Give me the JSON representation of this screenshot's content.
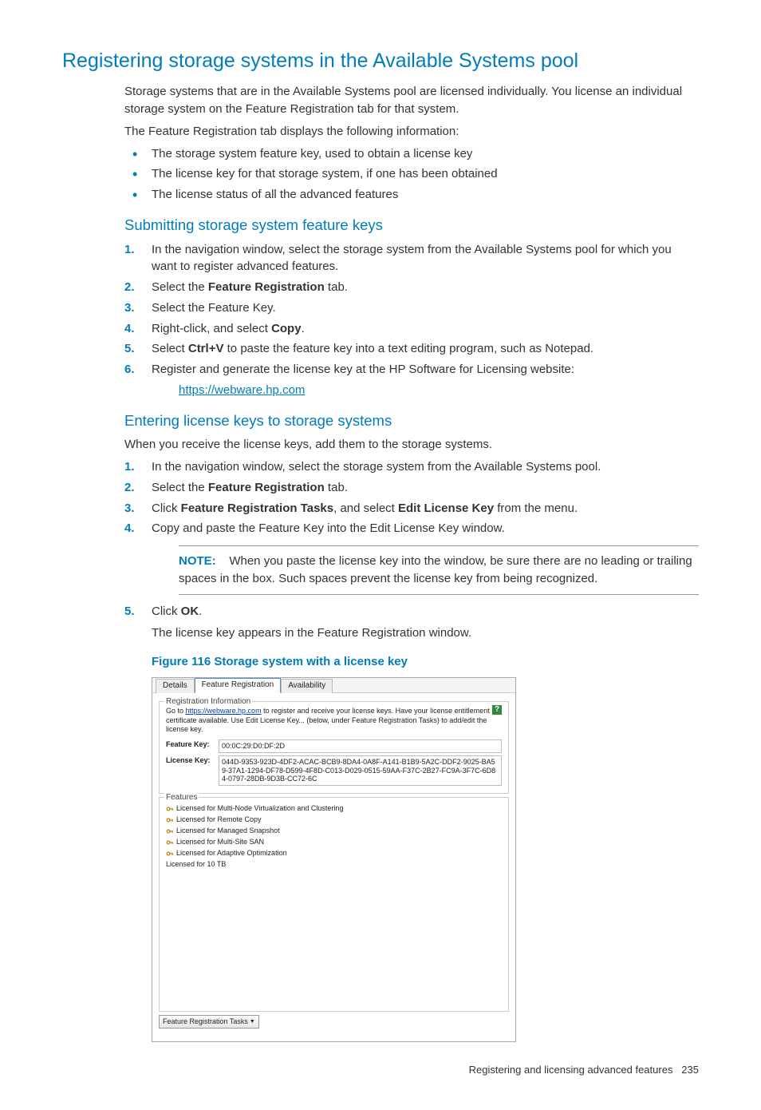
{
  "h1": "Registering storage systems in the Available Systems pool",
  "p1": "Storage systems that are in the Available Systems pool are licensed individually. You license an individual storage system on the Feature Registration tab for that system.",
  "p2": "The Feature Registration tab displays the following information:",
  "bullets": [
    "The storage system feature key, used to obtain a license key",
    "The license key for that storage system, if one has been obtained",
    "The license status of all the advanced features"
  ],
  "h2a": "Submitting storage system feature keys",
  "s1": {
    "1": "In the navigation window, select the storage system from the Available Systems pool for which you want to register advanced features.",
    "2a": "Select the ",
    "2b": "Feature Registration",
    "2c": " tab.",
    "3": "Select the Feature Key.",
    "4a": "Right-click, and select ",
    "4b": "Copy",
    "4c": ".",
    "5a": "Select ",
    "5b": "Ctrl+V",
    "5c": " to paste the feature key into a text editing program, such as Notepad.",
    "6": "Register and generate the license key at the HP Software for Licensing website:",
    "link": "https://webware.hp.com"
  },
  "h2b": "Entering license keys to storage systems",
  "p3": "When you receive the license keys, add them to the storage systems.",
  "s2": {
    "1": "In the navigation window, select the storage system from the Available Systems pool.",
    "2a": "Select the ",
    "2b": "Feature Registration",
    "2c": " tab.",
    "3a": "Click ",
    "3b": "Feature Registration Tasks",
    "3c": ", and select ",
    "3d": "Edit License Key",
    "3e": " from the menu.",
    "4": "Copy and paste the Feature Key into the Edit License Key window.",
    "5a": "Click ",
    "5b": "OK",
    "5c": "."
  },
  "note_label": "NOTE:",
  "note_text": "When you paste the license key into the window, be sure there are no leading or trailing spaces in the box. Such spaces prevent the license key from being recognized.",
  "p4": "The license key appears in the Feature Registration window.",
  "fig_caption": "Figure 116 Storage system with a license key",
  "shot": {
    "tabs": [
      "Details",
      "Feature Registration",
      "Availability"
    ],
    "legend1": "Registration Information",
    "help": "?",
    "reg_pre": "Go to ",
    "reg_link": "https://webware.hp.com",
    "reg_post": " to register and receive your license keys. Have your license entitlement certificate available. Use Edit License Key... (below, under Feature Registration Tasks) to add/edit the license key.",
    "fk_label": "Feature Key:",
    "fk_val": "00:0C:29:D0:DF:2D",
    "lk_label": "License Key:",
    "lk_val": "044D-9353-923D-4DF2-ACAC-BCB9-8DA4-0A8F-A141-B1B9-5A2C-DDF2-9025-BA59-37A1-1294-DF78-D599-4F8D-C013-D029-0515-59AA-F37C-2B27-FC9A-3F7C-6D84-0797-28DB-9D3B-CC72-6C",
    "legend2": "Features",
    "feat": [
      "Licensed for Multi-Node Virtualization and Clustering",
      "Licensed for Remote Copy",
      "Licensed for Managed Snapshot",
      "Licensed for Multi-Site SAN",
      "Licensed for Adaptive Optimization"
    ],
    "feat_last": "Licensed for 10 TB",
    "btn": "Feature Registration Tasks"
  },
  "footer_text": "Registering and licensing advanced features",
  "footer_page": "235"
}
